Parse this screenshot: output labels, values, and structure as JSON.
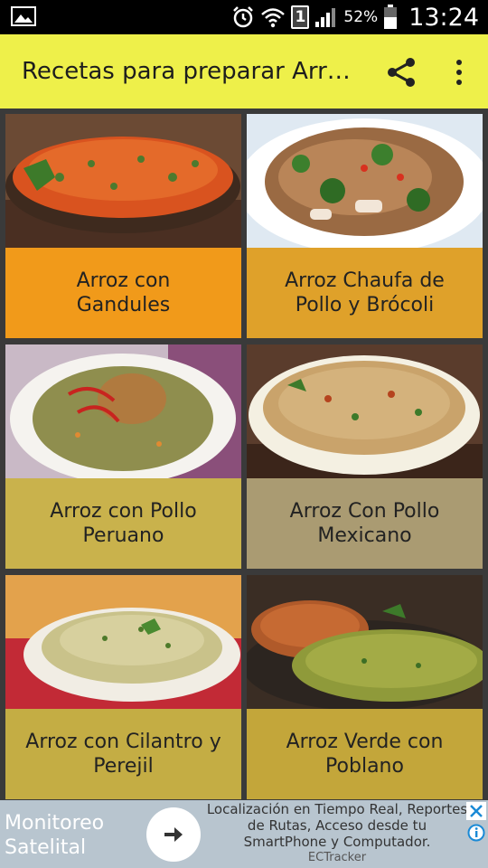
{
  "status_bar": {
    "battery_percent": "52%",
    "time": "13:24",
    "sim_badge": "1",
    "left_icon": "image-icon",
    "icons": [
      "alarm-icon",
      "wifi-icon",
      "sim-icon",
      "signal-icon",
      "battery-icon"
    ]
  },
  "app_bar": {
    "title": "Recetas para preparar Arr…",
    "background": "#eef04a",
    "actions": [
      "share-icon",
      "overflow-menu-icon"
    ]
  },
  "recipes": [
    {
      "line1": "Arroz con",
      "line2": "Gandules",
      "color": "#f19a1a"
    },
    {
      "line1": "Arroz Chaufa de",
      "line2": "Pollo y Brócoli",
      "color": "#dfa12a"
    },
    {
      "line1": "Arroz con Pollo",
      "line2": "Peruano",
      "color": "#c9b24c"
    },
    {
      "line1": "Arroz Con Pollo",
      "line2": "Mexicano",
      "color": "#aa9b72"
    },
    {
      "line1": "Arroz con Cilantro y",
      "line2": "Perejil",
      "color": "#c4ad44"
    },
    {
      "line1": "Arroz Verde con",
      "line2": "Poblano",
      "color": "#c3a63a"
    }
  ],
  "ad": {
    "title": "Monitoreo Satelital",
    "description": "Localización en Tiempo Real, Reportes de Rutas, Acceso desde tu SmartPhone y Computador.",
    "brand": "ECTracker",
    "icons": [
      "arrow-right-icon",
      "close-icon",
      "info-icon"
    ]
  }
}
